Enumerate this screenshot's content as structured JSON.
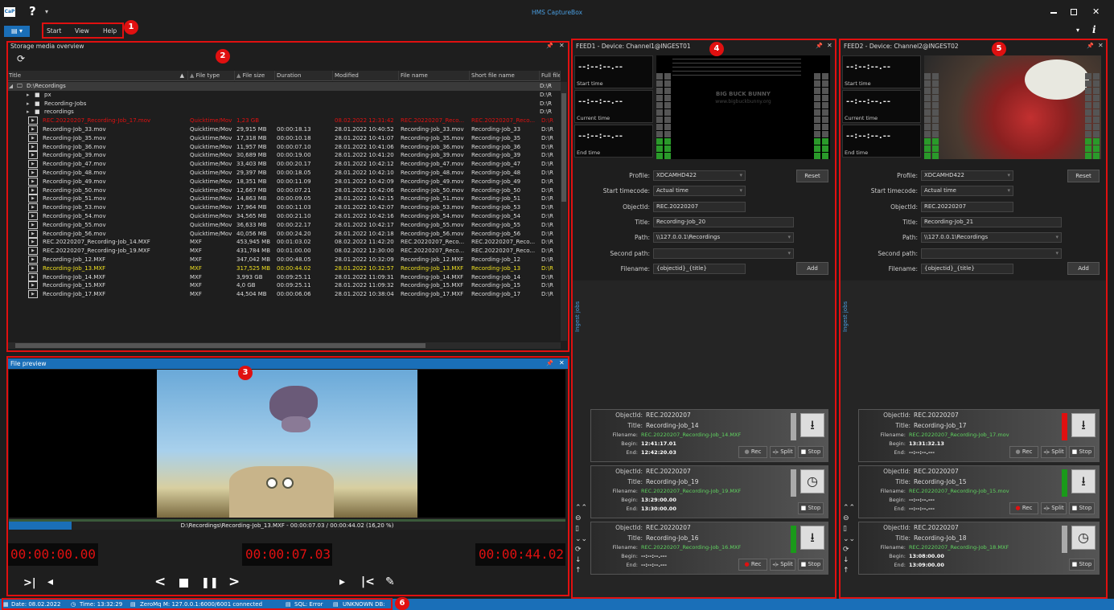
{
  "app": {
    "title": "HMS CaptureBox",
    "logo": "CaP",
    "help_glyph": "?"
  },
  "menu": {
    "items": [
      "Start",
      "View",
      "Help"
    ]
  },
  "badges": [
    "1",
    "2",
    "3",
    "4",
    "5",
    "6"
  ],
  "storage": {
    "title": "Storage media overview",
    "columns": [
      "Title",
      "File type",
      "File size",
      "Duration",
      "Modified",
      "File name",
      "Short file name",
      "Full file p"
    ],
    "tree": [
      "D:\\Recordings",
      "px",
      "Recording-Jobs",
      "recordings"
    ],
    "rows": [
      {
        "title": "REC.20220207_Recording-Job_17.mov",
        "type": "Quicktime/Mov",
        "size": "1,23 GB",
        "dur": "",
        "mod": "08.02.2022 12:31:42",
        "fname": "REC.20220207_Reco...",
        "short": "REC.20220207_Reco...",
        "full": "D:\\R",
        "style": "red"
      },
      {
        "title": "Recording-Job_33.mov",
        "type": "Quicktime/Mov",
        "size": "29,915 MB",
        "dur": "00:00:18.13",
        "mod": "28.01.2022 10:40:52",
        "fname": "Recording-Job_33.mov",
        "short": "Recording-Job_33",
        "full": "D:\\R",
        "style": ""
      },
      {
        "title": "Recording-Job_35.mov",
        "type": "Quicktime/Mov",
        "size": "17,318 MB",
        "dur": "00:00:10.18",
        "mod": "28.01.2022 10:41:07",
        "fname": "Recording-Job_35.mov",
        "short": "Recording-Job_35",
        "full": "D:\\R",
        "style": ""
      },
      {
        "title": "Recording-Job_36.mov",
        "type": "Quicktime/Mov",
        "size": "11,957 MB",
        "dur": "00:00:07.10",
        "mod": "28.01.2022 10:41:06",
        "fname": "Recording-Job_36.mov",
        "short": "Recording-Job_36",
        "full": "D:\\R",
        "style": ""
      },
      {
        "title": "Recording-Job_39.mov",
        "type": "Quicktime/Mov",
        "size": "30,689 MB",
        "dur": "00:00:19.00",
        "mod": "28.01.2022 10:41:20",
        "fname": "Recording-Job_39.mov",
        "short": "Recording-Job_39",
        "full": "D:\\R",
        "style": ""
      },
      {
        "title": "Recording-Job_47.mov",
        "type": "Quicktime/Mov",
        "size": "33,403 MB",
        "dur": "00:00:20.17",
        "mod": "28.01.2022 10:42:12",
        "fname": "Recording-Job_47.mov",
        "short": "Recording-Job_47",
        "full": "D:\\R",
        "style": ""
      },
      {
        "title": "Recording-Job_48.mov",
        "type": "Quicktime/Mov",
        "size": "29,397 MB",
        "dur": "00:00:18.05",
        "mod": "28.01.2022 10:42:10",
        "fname": "Recording-Job_48.mov",
        "short": "Recording-Job_48",
        "full": "D:\\R",
        "style": ""
      },
      {
        "title": "Recording-Job_49.mov",
        "type": "Quicktime/Mov",
        "size": "18,351 MB",
        "dur": "00:00:11.09",
        "mod": "28.01.2022 10:42:09",
        "fname": "Recording-Job_49.mov",
        "short": "Recording-Job_49",
        "full": "D:\\R",
        "style": ""
      },
      {
        "title": "Recording-Job_50.mov",
        "type": "Quicktime/Mov",
        "size": "12,667 MB",
        "dur": "00:00:07.21",
        "mod": "28.01.2022 10:42:06",
        "fname": "Recording-Job_50.mov",
        "short": "Recording-Job_50",
        "full": "D:\\R",
        "style": ""
      },
      {
        "title": "Recording-Job_51.mov",
        "type": "Quicktime/Mov",
        "size": "14,863 MB",
        "dur": "00:00:09.05",
        "mod": "28.01.2022 10:42:15",
        "fname": "Recording-Job_51.mov",
        "short": "Recording-Job_51",
        "full": "D:\\R",
        "style": ""
      },
      {
        "title": "Recording-Job_53.mov",
        "type": "Quicktime/Mov",
        "size": "17,964 MB",
        "dur": "00:00:11.03",
        "mod": "28.01.2022 10:42:07",
        "fname": "Recording-Job_53.mov",
        "short": "Recording-Job_53",
        "full": "D:\\R",
        "style": ""
      },
      {
        "title": "Recording-Job_54.mov",
        "type": "Quicktime/Mov",
        "size": "34,565 MB",
        "dur": "00:00:21.10",
        "mod": "28.01.2022 10:42:16",
        "fname": "Recording-Job_54.mov",
        "short": "Recording-Job_54",
        "full": "D:\\R",
        "style": ""
      },
      {
        "title": "Recording-Job_55.mov",
        "type": "Quicktime/Mov",
        "size": "36,633 MB",
        "dur": "00:00:22.17",
        "mod": "28.01.2022 10:42:17",
        "fname": "Recording-Job_55.mov",
        "short": "Recording-Job_55",
        "full": "D:\\R",
        "style": ""
      },
      {
        "title": "Recording-Job_56.mov",
        "type": "Quicktime/Mov",
        "size": "40,056 MB",
        "dur": "00:00:24.20",
        "mod": "28.01.2022 10:42:18",
        "fname": "Recording-Job_56.mov",
        "short": "Recording-Job_56",
        "full": "D:\\R",
        "style": ""
      },
      {
        "title": "REC.20220207_Recording-Job_14.MXF",
        "type": "MXF",
        "size": "453,945 MB",
        "dur": "00:01:03.02",
        "mod": "08.02.2022 11:42:20",
        "fname": "REC.20220207_Reco...",
        "short": "REC.20220207_Reco...",
        "full": "D:\\R",
        "style": ""
      },
      {
        "title": "REC.20220207_Recording-Job_19.MXF",
        "type": "MXF",
        "size": "431,784 MB",
        "dur": "00:01:00.00",
        "mod": "08.02.2022 12:30:00",
        "fname": "REC.20220207_Reco...",
        "short": "REC.20220207_Reco...",
        "full": "D:\\R",
        "style": ""
      },
      {
        "title": "Recording-Job_12.MXF",
        "type": "MXF",
        "size": "347,042 MB",
        "dur": "00:00:48.05",
        "mod": "28.01.2022 10:32:09",
        "fname": "Recording-Job_12.MXF",
        "short": "Recording-Job_12",
        "full": "D:\\R",
        "style": ""
      },
      {
        "title": "Recording-Job_13.MXF",
        "type": "MXF",
        "size": "317,525 MB",
        "dur": "00:00:44.02",
        "mod": "28.01.2022 10:32:57",
        "fname": "Recording-Job_13.MXF",
        "short": "Recording-Job_13",
        "full": "D:\\R",
        "style": "yellow"
      },
      {
        "title": "Recording-Job_14.MXF",
        "type": "MXF",
        "size": "3,993 GB",
        "dur": "00:09:25.11",
        "mod": "28.01.2022 11:09:31",
        "fname": "Recording-Job_14.MXF",
        "short": "Recording-Job_14",
        "full": "D:\\R",
        "style": ""
      },
      {
        "title": "Recording-Job_15.MXF",
        "type": "MXF",
        "size": "4,0 GB",
        "dur": "00:09:25.11",
        "mod": "28.01.2022 11:09:32",
        "fname": "Recording-Job_15.MXF",
        "short": "Recording-Job_15",
        "full": "D:\\R",
        "style": ""
      },
      {
        "title": "Recording-Job_17.MXF",
        "type": "MXF",
        "size": "44,504 MB",
        "dur": "00:00:06.06",
        "mod": "28.01.2022 10:38:04",
        "fname": "Recording-Job_17.MXF",
        "short": "Recording-Job_17",
        "full": "D:\\R",
        "style": ""
      }
    ]
  },
  "preview": {
    "title": "File preview",
    "status": "D:\\Recordings\\Recording-Job_13.MXF - 00:00:07.03 / 00:00:44.02 (16,20 %)",
    "progress": 0.162,
    "tc_start": "00:00:00.00",
    "tc_current": "00:00:07.03",
    "tc_end": "00:00:44.02"
  },
  "feeds": [
    {
      "title": "FEED1 - Device: Channel1@INGEST01",
      "tc_placeholder": "--:--:--.--",
      "tc_labels": [
        "Start time",
        "Current time",
        "End time"
      ],
      "video_text": "BIG BUCK BUNNY",
      "video_url": "www.bigbuckbunny.org",
      "labels": {
        "profile": "Profile:",
        "start_tc": "Start timecode:",
        "objectid": "ObjectId:",
        "title": "Title:",
        "path": "Path:",
        "second_path": "Second path:",
        "filename": "Filename:"
      },
      "profile": "XDCAMHD422",
      "start_tc": "Actual time",
      "objectid": "REC.20220207",
      "job_title": "Recording-Job_20",
      "path": "\\\\127.0.0.1\\Recordings",
      "second_path": "",
      "filename": "{objectid}_{title}",
      "reset": "Reset",
      "add": "Add",
      "ingest_tab": "Ingest jobs",
      "jobs": [
        {
          "objectid": "REC.20220207",
          "title": "Recording-Job_14",
          "filename": "REC.20220207_Recording-Job_14.MXF",
          "begin": "12:41:17.01",
          "end": "12:42:20.03",
          "indicator": "#aaaaaa",
          "icon": "download",
          "buttons": [
            "Rec",
            "Split",
            "Stop"
          ],
          "rec_active": false
        },
        {
          "objectid": "REC.20220207",
          "title": "Recording-Job_19",
          "filename": "REC.20220207_Recording-Job_19.MXF",
          "begin": "13:29:00.00",
          "end": "13:30:00.00",
          "indicator": "#aaaaaa",
          "icon": "clock",
          "buttons": [
            "Stop"
          ],
          "rec_active": false
        },
        {
          "objectid": "REC.20220207",
          "title": "Recording-Job_16",
          "filename": "REC.20220207_Recording-Job_16.MXF",
          "begin": "--:--:--.---",
          "end": "--:--:--.---",
          "indicator": "#1a9a1a",
          "icon": "download",
          "buttons": [
            "Rec",
            "Split",
            "Stop"
          ],
          "rec_active": true
        }
      ]
    },
    {
      "title": "FEED2 - Device: Channel2@INGEST02",
      "tc_placeholder": "--:--:--.--",
      "tc_labels": [
        "Start time",
        "Current time",
        "End time"
      ],
      "video_text": "",
      "video_url": "",
      "labels": {
        "profile": "Profile:",
        "start_tc": "Start timecode:",
        "objectid": "ObjectId:",
        "title": "Title:",
        "path": "Path:",
        "second_path": "Second path:",
        "filename": "Filename:"
      },
      "profile": "XDCAMHD422",
      "start_tc": "Actual time",
      "objectid": "REC.20220207",
      "job_title": "Recording-Job_21",
      "path": "\\\\127.0.0.1\\Recordings",
      "second_path": "",
      "filename": "{objectid}_{title}",
      "reset": "Reset",
      "add": "Add",
      "ingest_tab": "Ingest jobs",
      "jobs": [
        {
          "objectid": "REC.20220207",
          "title": "Recording-Job_17",
          "filename": "REC.20220207_Recording-Job_17.mov",
          "begin": "13:31:32.13",
          "end": "--:--:--.---",
          "indicator": "#e01010",
          "icon": "download",
          "buttons": [
            "Rec",
            "Split",
            "Stop"
          ],
          "rec_active": false
        },
        {
          "objectid": "REC.20220207",
          "title": "Recording-Job_15",
          "filename": "REC.20220207_Recording-Job_15.mov",
          "begin": "--:--:--.---",
          "end": "--:--:--.---",
          "indicator": "#1a9a1a",
          "icon": "download",
          "buttons": [
            "Rec",
            "Split",
            "Stop"
          ],
          "rec_active": true
        },
        {
          "objectid": "REC.20220207",
          "title": "Recording-Job_18",
          "filename": "REC.20220207_Recording-Job_18.MXF",
          "begin": "13:08:00.00",
          "end": "13:09:00.00",
          "indicator": "#aaaaaa",
          "icon": "clock",
          "buttons": [
            "Stop"
          ],
          "rec_active": false
        }
      ]
    }
  ],
  "job_labels": {
    "objectid": "ObjectId:",
    "title": "Title:",
    "filename": "Filename:",
    "begin": "Begin:",
    "end": "End:"
  },
  "status": {
    "date": "Date: 08.02.2022",
    "time": "Time: 13:32:29",
    "zeromq": "ZeroMq M: 127.0.0.1:6000/6001 connected",
    "sql": "SQL: Error",
    "db": "UNKNOWN DB:"
  },
  "colors": {
    "accent": "#1a6fb8",
    "highlight_red": "#e01010",
    "highlight_yellow": "#f0e020",
    "filename_green": "#5fd35f"
  }
}
